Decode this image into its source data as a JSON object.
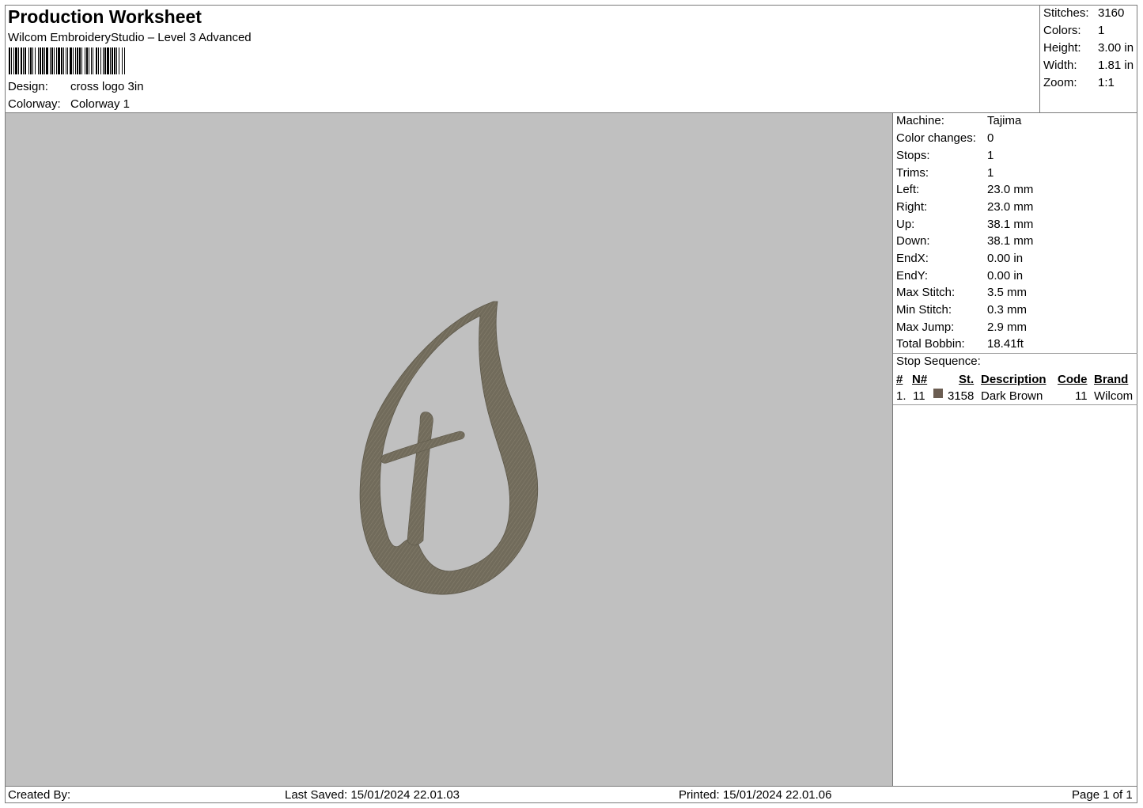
{
  "header": {
    "title": "Production Worksheet",
    "subtitle": "Wilcom EmbroideryStudio – Level 3 Advanced",
    "design_label": "Design:",
    "design_value": "cross logo 3in",
    "colorway_label": "Colorway:",
    "colorway_value": "Colorway 1"
  },
  "stats": [
    {
      "label": "Stitches:",
      "value": "3160"
    },
    {
      "label": "Colors:",
      "value": "1"
    },
    {
      "label": "Height:",
      "value": "3.00 in"
    },
    {
      "label": "Width:",
      "value": "1.81 in"
    },
    {
      "label": "Zoom:",
      "value": "1:1"
    }
  ],
  "machine_info": [
    {
      "label": "Machine:",
      "value": "Tajima"
    },
    {
      "label": "Color changes:",
      "value": "0"
    },
    {
      "label": "Stops:",
      "value": "1"
    },
    {
      "label": "Trims:",
      "value": "1"
    },
    {
      "label": "Left:",
      "value": "23.0 mm"
    },
    {
      "label": "Right:",
      "value": "23.0 mm"
    },
    {
      "label": "Up:",
      "value": "38.1 mm"
    },
    {
      "label": "Down:",
      "value": "38.1 mm"
    },
    {
      "label": "EndX:",
      "value": "0.00 in"
    },
    {
      "label": "EndY:",
      "value": "0.00 in"
    },
    {
      "label": "Max Stitch:",
      "value": "3.5 mm"
    },
    {
      "label": "Min Stitch:",
      "value": "0.3 mm"
    },
    {
      "label": "Max Jump:",
      "value": "2.9 mm"
    },
    {
      "label": "Total Bobbin:",
      "value": "18.41ft"
    }
  ],
  "stop_sequence": {
    "title": "Stop Sequence:",
    "headers": {
      "num": "#",
      "needle": "N#",
      "stitches": "St.",
      "description": "Description",
      "code": "Code",
      "brand": "Brand"
    },
    "rows": [
      {
        "num": "1.",
        "needle": "11",
        "stitches": "3158",
        "description": "Dark Brown",
        "code": "11",
        "brand": "Wilcom",
        "color": "#6b5d52"
      }
    ]
  },
  "footer": {
    "created_by": "Created By:",
    "last_saved": "Last Saved: 15/01/2024 22.01.03",
    "printed": "Printed: 15/01/2024 22.01.06",
    "page": "Page 1 of 1"
  },
  "colors": {
    "canvas_bg": "#c0c0c0",
    "thread": "#706a5a"
  }
}
